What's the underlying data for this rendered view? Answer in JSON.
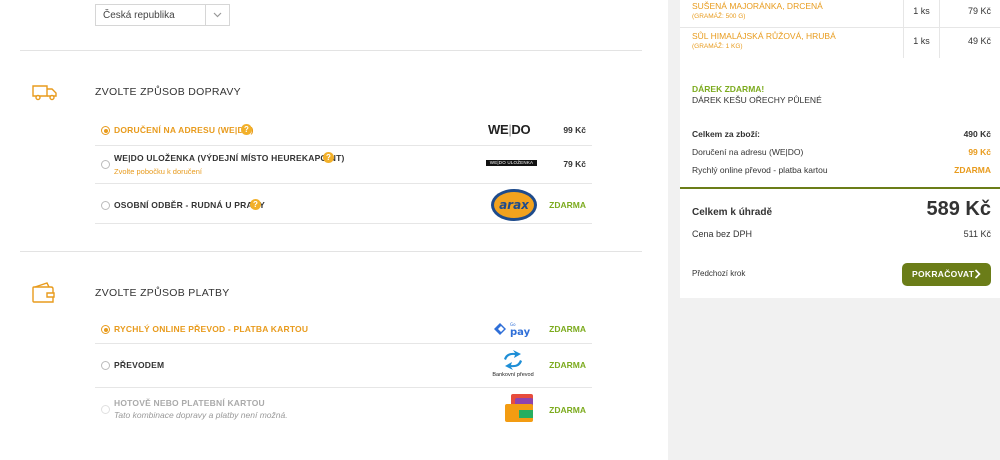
{
  "address": {
    "country_value": "Česká republika"
  },
  "shipping": {
    "title": "Zvolte způsob dopravy",
    "options": [
      {
        "label": "Doručení na adresu (WE|DO)",
        "sub": "",
        "price": "99 Kč",
        "logo_text": "WE|DO",
        "selected": true
      },
      {
        "label": "WE|DO Uloženka (výdejní místo HeurekaPoint)",
        "sub": "Zvolte pobočku k doručení",
        "price": "79 Kč",
        "logo_text": "WE|DO ULOŽENKA",
        "selected": false
      },
      {
        "label": "Osobní odběr - Rudná u Prahy",
        "sub": "",
        "price": "ZDARMA",
        "logo_text": "arax",
        "selected": false
      }
    ]
  },
  "payment": {
    "title": "Zvolte způsob platby",
    "options": [
      {
        "label": "Rychlý online převod - platba kartou",
        "sub": "",
        "price": "ZDARMA",
        "logo_text": "pay",
        "selected": true
      },
      {
        "label": "Převodem",
        "sub": "",
        "price": "ZDARMA",
        "logo_text": "Bankovní převod",
        "selected": false
      },
      {
        "label": "Hotově nebo platební kartou",
        "sub": "Tato kombinace dopravy a platby není možná.",
        "price": "ZDARMA",
        "logo_text": "",
        "selected": false
      }
    ]
  },
  "summary": {
    "items": [
      {
        "name": "Sušená majoránka, drcená",
        "note": "(gramáž: 500 g)",
        "qty": "1 ks",
        "price": "79 Kč"
      },
      {
        "name": "Sůl himalájská růžová, hrubá",
        "note": "(gramáž: 1 kg)",
        "qty": "1 ks",
        "price": "49 Kč"
      }
    ],
    "gift_title": "Dárek zdarma!",
    "gift_text": "Dárek kešu ořechy půlené",
    "goods_label": "Celkem za zboží:",
    "goods_value": "490 Kč",
    "shipping_label": "Doručení na adresu (WE|DO)",
    "shipping_value": "99 Kč",
    "payment_label": "Rychlý online převod - platba kartou",
    "payment_value": "zdarma",
    "total_label": "Celkem k úhradě",
    "total_value": "589 Kč",
    "vat_label": "Cena bez DPH",
    "vat_value": "511 Kč",
    "prev_label": "Předchozí krok",
    "continue_label": "Pokračovat"
  },
  "colors": {
    "accent_orange": "#e89b1d",
    "free_green": "#7cab1e",
    "button_olive": "#6b7d18"
  }
}
